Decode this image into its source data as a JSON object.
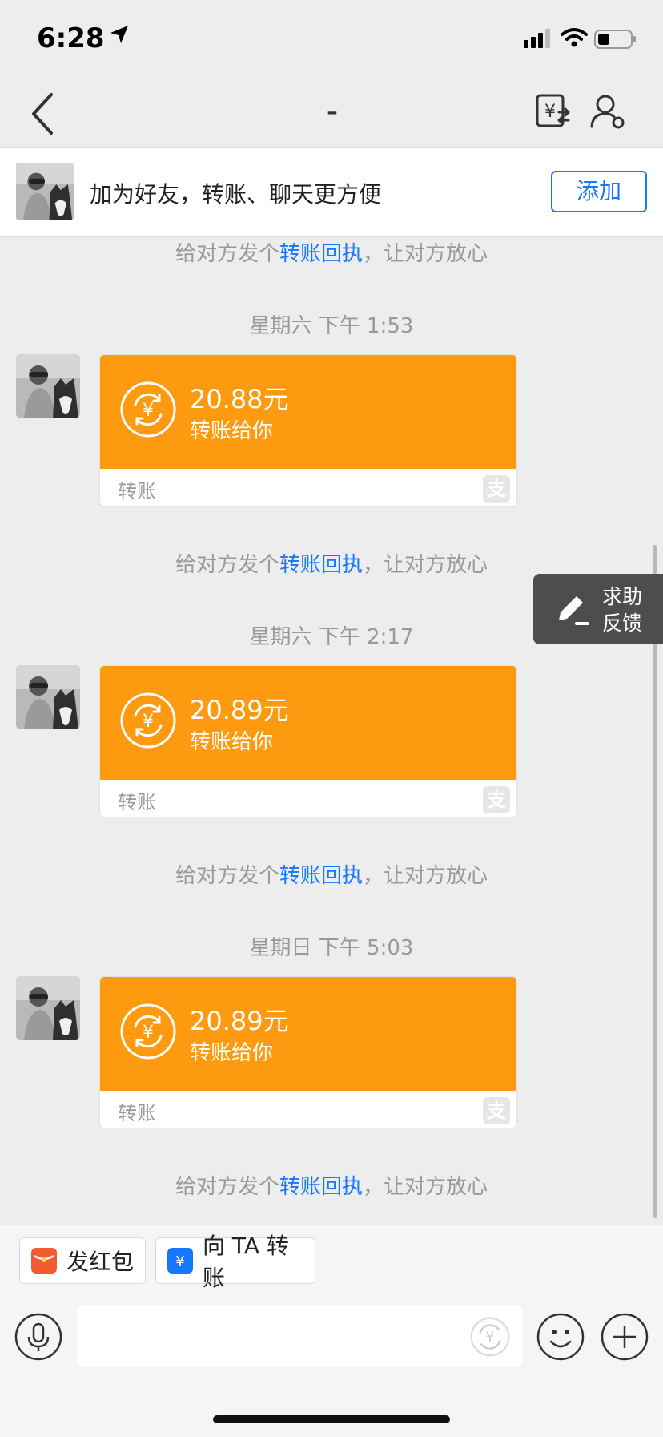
{
  "status_bar": {
    "time": "6:28"
  },
  "nav": {
    "title": "-"
  },
  "banner": {
    "text": "加为好友，转账、聊天更方便",
    "add_label": "添加"
  },
  "hint": {
    "prefix": "给对方发个",
    "link": "转账回执",
    "suffix": "，让对方放心"
  },
  "messages": [
    {
      "time": "星期六 下午 1:53",
      "amount": "20.88元",
      "desc": "转账给你",
      "label": "转账"
    },
    {
      "time": "星期六 下午 2:17",
      "amount": "20.89元",
      "desc": "转账给你",
      "label": "转账"
    },
    {
      "time": "星期日 下午 5:03",
      "amount": "20.89元",
      "desc": "转账给你",
      "label": "转账"
    }
  ],
  "feedback": {
    "line1": "求助",
    "line2": "反馈"
  },
  "quick_actions": {
    "red_packet": "发红包",
    "transfer": "向 TA 转账"
  },
  "colors": {
    "orange": "#fd9a0f",
    "blue": "#1677ff",
    "red": "#f25a2f",
    "alipay_blue": "#1677ff"
  },
  "icons": {
    "alipay_mark": "支",
    "yuan_symbol": "¥"
  }
}
